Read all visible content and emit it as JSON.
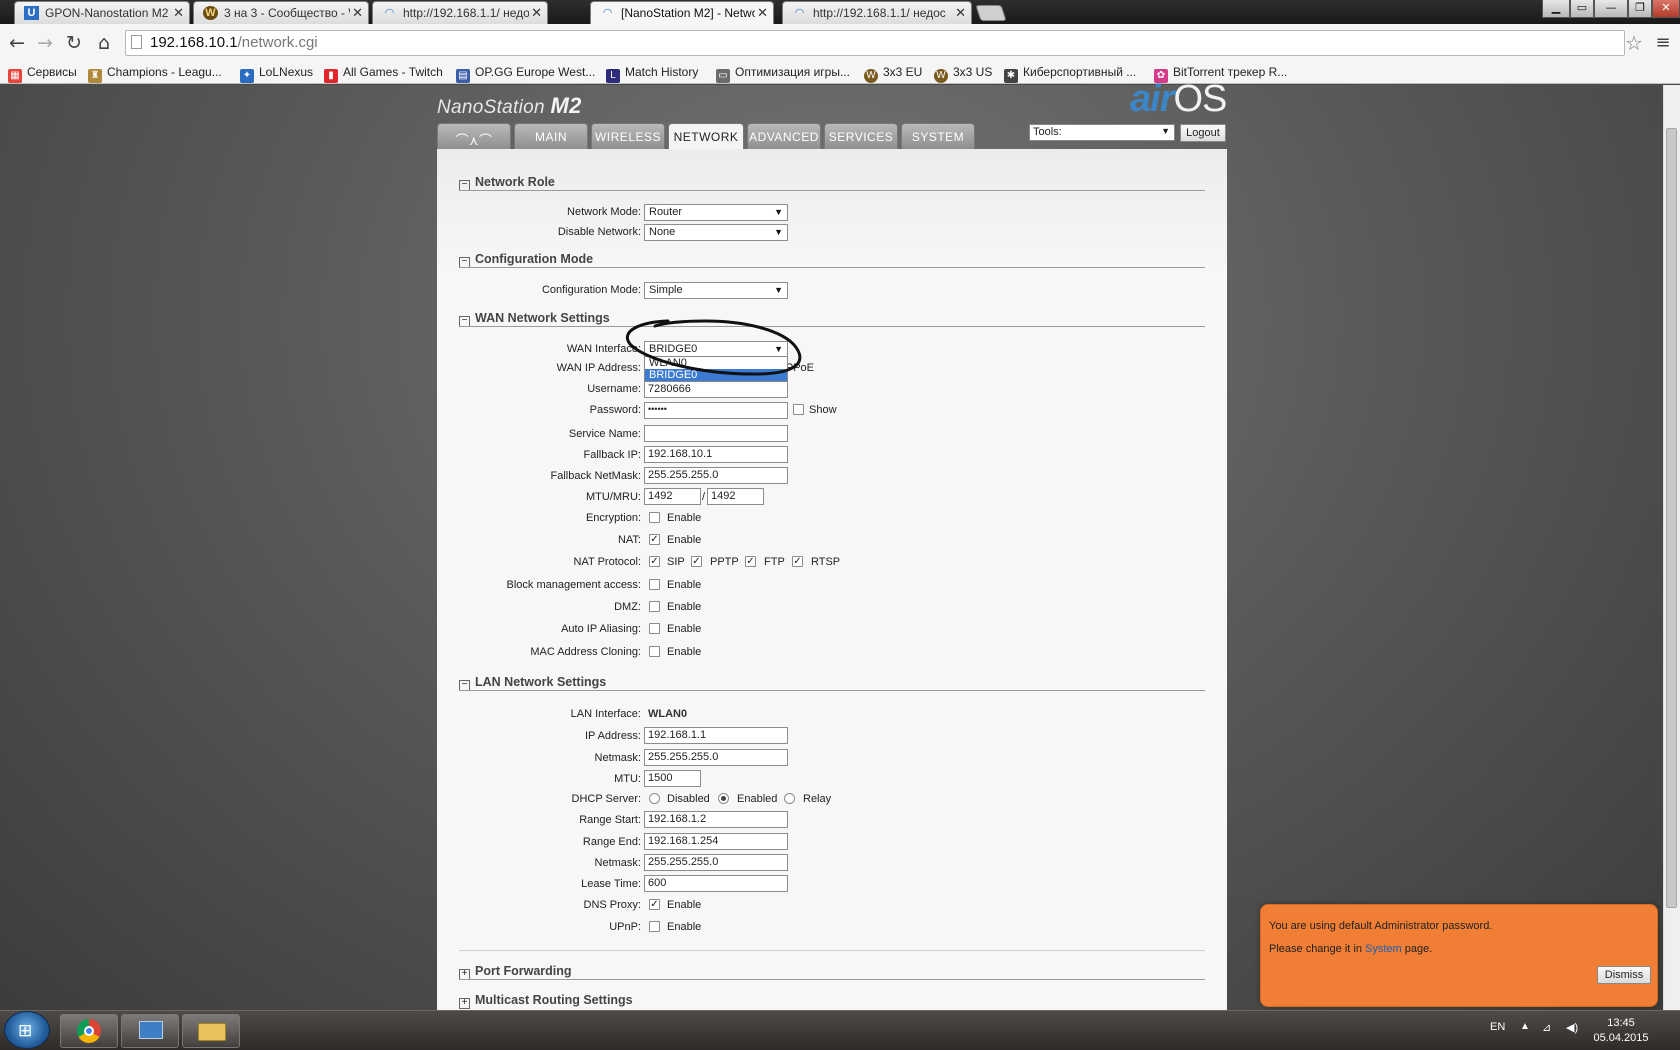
{
  "browser": {
    "tabs": [
      {
        "title": "GPON-Nanostation M2 - ",
        "favicon": "u-icon",
        "active": false
      },
      {
        "title": "3 на 3 - Сообщество - W",
        "favicon": "wow-icon",
        "active": false
      },
      {
        "title": "http://192.168.1.1/ недос",
        "favicon": "wifi-icon",
        "active": false
      },
      {
        "title": "[NanoStation M2] - Netwo",
        "favicon": "wifi-icon",
        "active": true
      },
      {
        "title": "http://192.168.1.1/ недос",
        "favicon": "wifi-icon",
        "active": false
      }
    ],
    "url_host": "192.168.10.1",
    "url_path": "/network.cgi",
    "bookmarks": [
      {
        "label": "Сервисы",
        "icon": "apps-icon",
        "color": "#e8453c"
      },
      {
        "label": "Champions - Leagu...",
        "icon": "lol-icon",
        "color": "#b08a3a"
      },
      {
        "label": "LoLNexus",
        "icon": "lolnexus-icon",
        "color": "#2a6cbf"
      },
      {
        "label": "All Games - Twitch",
        "icon": "twitch-icon",
        "color": "#e0262c"
      },
      {
        "label": "OP.GG Europe West...",
        "icon": "opgg-icon",
        "color": "#3a5ea8"
      },
      {
        "label": "Match History",
        "icon": "match-icon",
        "color": "#2c2c7a"
      },
      {
        "label": "Оптимизация игры...",
        "icon": "doc-icon",
        "color": "#6b6b6b"
      },
      {
        "label": "3x3 EU",
        "icon": "wow-icon",
        "color": "#7a5a1e"
      },
      {
        "label": "3x3 US",
        "icon": "wow-icon",
        "color": "#7a5a1e"
      },
      {
        "label": "Киберспортивный ...",
        "icon": "esport-icon",
        "color": "#444444"
      },
      {
        "label": "BitTorrent трекер R...",
        "icon": "torrent-icon",
        "color": "#d33a8a"
      }
    ]
  },
  "header": {
    "brand": "NanoStation",
    "model": "M2",
    "logo_air": "air",
    "logo_os": "OS",
    "tabs": [
      "MAIN",
      "WIRELESS",
      "NETWORK",
      "ADVANCED",
      "SERVICES",
      "SYSTEM"
    ],
    "active_tab": "NETWORK",
    "tools_label": "Tools:",
    "logout_label": "Logout"
  },
  "network_role": {
    "heading": "Network Role",
    "mode_label": "Network Mode:",
    "mode_value": "Router",
    "disable_label": "Disable Network:",
    "disable_value": "None"
  },
  "configuration_mode": {
    "heading": "Configuration Mode",
    "label": "Configuration Mode:",
    "value": "Simple"
  },
  "wan": {
    "heading": "WAN Network Settings",
    "interface_label": "WAN Interface:",
    "interface_value": "BRIDGE0",
    "interface_options": [
      "WLAN0",
      "BRIDGE0"
    ],
    "ip_label": "WAN IP Address:",
    "ip_option_visible": "PPPoE",
    "username_label": "Username:",
    "username_value": "7280666",
    "password_label": "Password:",
    "password_value": "••••••",
    "show_label": "Show",
    "service_label": "Service Name:",
    "service_value": "",
    "fallback_ip_label": "Fallback IP:",
    "fallback_ip_value": "192.168.10.1",
    "fallback_mask_label": "Fallback NetMask:",
    "fallback_mask_value": "255.255.255.0",
    "mtu_label": "MTU/MRU:",
    "mtu_value": "1492",
    "mtu_sep": "/",
    "mru_value": "1492",
    "encryption_label": "Encryption:",
    "nat_label": "NAT:",
    "nat_protocol_label": "NAT Protocol:",
    "nat_protocols": [
      "SIP",
      "PPTP",
      "FTP",
      "RTSP"
    ],
    "block_label": "Block management access:",
    "dmz_label": "DMZ:",
    "auto_ip_label": "Auto IP Aliasing:",
    "mac_clone_label": "MAC Address Cloning:",
    "enable_label": "Enable"
  },
  "lan": {
    "heading": "LAN Network Settings",
    "interface_label": "LAN Interface:",
    "interface_value": "WLAN0",
    "ip_label": "IP Address:",
    "ip_value": "192.168.1.1",
    "netmask_label": "Netmask:",
    "netmask_value": "255.255.255.0",
    "mtu_label": "MTU:",
    "mtu_value": "1500",
    "dhcp_label": "DHCP Server:",
    "dhcp_options": [
      "Disabled",
      "Enabled",
      "Relay"
    ],
    "dhcp_selected": "Enabled",
    "range_start_label": "Range Start:",
    "range_start_value": "192.168.1.2",
    "range_end_label": "Range End:",
    "range_end_value": "192.168.1.254",
    "dhcp_netmask_label": "Netmask:",
    "dhcp_netmask_value": "255.255.255.0",
    "lease_label": "Lease Time:",
    "lease_value": "600",
    "dns_proxy_label": "DNS Proxy:",
    "upnp_label": "UPnP:",
    "enable_label": "Enable"
  },
  "collapsed_sections": [
    "Port Forwarding",
    "Multicast Routing Settings"
  ],
  "notification": {
    "line1": "You are using default Administrator password.",
    "line2_pre": "Please change it in ",
    "line2_link": "System",
    "line2_post": " page.",
    "dismiss_label": "Dismiss",
    "color": "#f07e34"
  },
  "taskbar": {
    "lang": "EN",
    "time": "13:45",
    "date": "05.04.2015"
  }
}
